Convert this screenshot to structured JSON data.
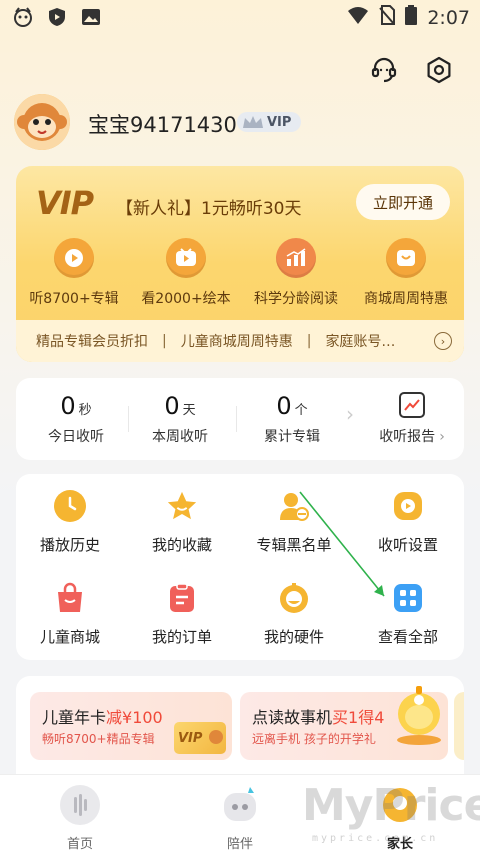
{
  "status_bar": {
    "time": "2:07"
  },
  "profile": {
    "username": "宝宝94171430",
    "vip_badge": "VIP"
  },
  "vip_card": {
    "logo": "VIP",
    "promo": "【新人礼】1元畅听30天",
    "open_button": "立即开通",
    "benefits": [
      {
        "label": "听8700+专辑",
        "icon": "play-icon"
      },
      {
        "label": "看2000+绘本",
        "icon": "video-icon"
      },
      {
        "label": "科学分龄阅读",
        "icon": "chart-icon"
      },
      {
        "label": "商城周周特惠",
        "icon": "shop-icon"
      }
    ],
    "strip": [
      "精品专辑会员折扣",
      "儿童商城周周特惠",
      "家庭账号…"
    ]
  },
  "stats": {
    "items": [
      {
        "value": "0",
        "unit": "秒",
        "label": "今日收听"
      },
      {
        "value": "0",
        "unit": "天",
        "label": "本周收听"
      },
      {
        "value": "0",
        "unit": "个",
        "label": "累计专辑"
      }
    ],
    "report_label": "收听报告"
  },
  "functions": [
    {
      "label": "播放历史",
      "icon": "clock-icon",
      "color": "#f5b531"
    },
    {
      "label": "我的收藏",
      "icon": "star-icon",
      "color": "#f5b531"
    },
    {
      "label": "专辑黑名单",
      "icon": "user-block-icon",
      "color": "#f5b531"
    },
    {
      "label": "收听设置",
      "icon": "listen-settings-icon",
      "color": "#f5b531"
    },
    {
      "label": "儿童商城",
      "icon": "shopping-bag-icon",
      "color": "#f0605a"
    },
    {
      "label": "我的订单",
      "icon": "order-icon",
      "color": "#f0605a"
    },
    {
      "label": "我的硬件",
      "icon": "hardware-icon",
      "color": "#f5b531"
    },
    {
      "label": "查看全部",
      "icon": "grid-icon",
      "color": "#3ca0f5"
    }
  ],
  "promos": [
    {
      "title": "儿童年卡",
      "highlight": "减¥100",
      "sub": "畅听8700+精品专辑"
    },
    {
      "title": "点读故事机",
      "highlight": "买1得4",
      "sub": "远离手机 孩子的开学礼"
    }
  ],
  "bottom_nav": [
    {
      "label": "首页",
      "icon": "home-icon"
    },
    {
      "label": "陪伴",
      "icon": "companion-icon"
    },
    {
      "label": "家长",
      "icon": "parent-icon"
    }
  ],
  "watermark": {
    "text": "MyPrice",
    "sub": "myprice.com.cn"
  },
  "colors": {
    "accent": "#f5b531",
    "vip_gold": "#fcd66e",
    "red": "#f0605a",
    "blue": "#3ca0f5"
  }
}
